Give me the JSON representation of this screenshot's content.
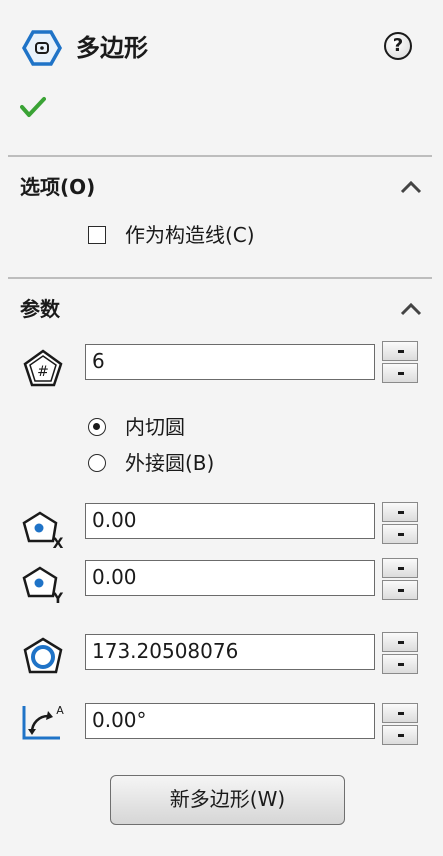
{
  "header": {
    "title": "多边形",
    "help_label": "?"
  },
  "options": {
    "title": "选项(O)",
    "construction_label": "作为构造线(C)",
    "construction_checked": false
  },
  "params": {
    "title": "参数",
    "sides": "6",
    "inscribed_label": "内切圆",
    "circumscribed_label": "外接圆(B)",
    "selected_mode": "inscribed",
    "center_x": "0.00",
    "center_y": "0.00",
    "diameter": "173.20508076",
    "angle": "0.00°",
    "angle_icon_letter": "A"
  },
  "new_polygon_button": "新多边形(W)",
  "colors": {
    "accent_blue": "#1f73c7",
    "confirm_green": "#3aa335"
  }
}
